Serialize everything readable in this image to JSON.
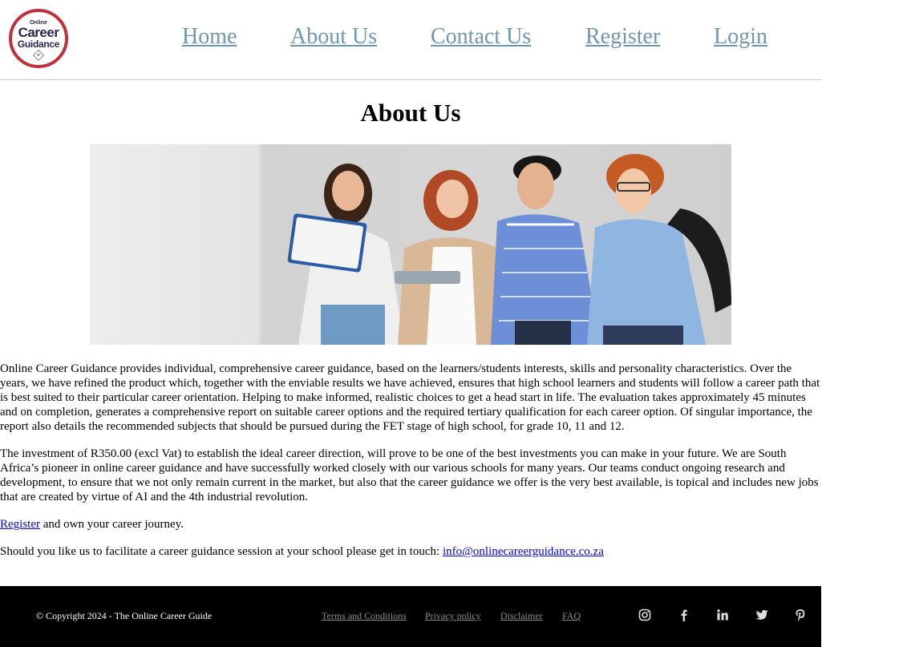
{
  "logo": {
    "line1": "Online",
    "line2": "Career",
    "line3": "Guidance"
  },
  "nav": {
    "home": "Home",
    "about": "About Us",
    "contact": "Contact Us",
    "register": "Register",
    "login": "Login"
  },
  "main": {
    "title": "About Us",
    "paragraph1": "Online Career Guidance provides individual, comprehensive career guidance, based on the learners/students interests, skills and personality characteristics. Over the years, we have refined the product which, together with the enviable results we have achieved, ensures that high school learners and students will follow a career path that is best suited to their particular career orientation. Helping to make informed, realistic choices to get a head start in life. The evaluation takes approximately 45 minutes and on completion, generates a comprehensive report on suitable career options and the required tertiary qualification for each career option. Of singular importance, the report also details the recommended subjects that should be pursued during the FET stage of high school, for grade 10, 11 and 12.",
    "paragraph2": "The investment of R350.00 (excl Vat) to establish the ideal career direction, will prove to be one of the best investments you can make in your future. We are South Africa’s pioneer in online career guidance and have successfully worked closely with our various schools for many years. Our teams conduct ongoing research and development, to ensure that we not only remain current in the market, but also that the career guidance we offer is the very best available, is topical and includes new jobs that are created by virtue of AI and the 4th industrial revolution.",
    "register_link": "Register",
    "register_suffix": " and own your career journey.",
    "contact_prefix": "Should you like us to facilitate a career guidance session at your school please get in touch: ",
    "contact_email": "info@onlinecareerguidance.co.za"
  },
  "footer": {
    "copyright": "© Copyright 2024 - The Online Career Guide",
    "terms": "Terms and Conditions",
    "privacy": "Privacy policy",
    "disclaimer": "Disclaimer",
    "faq": "FAQ",
    "social_icons": [
      "instagram-icon",
      "facebook-icon",
      "linkedin-icon",
      "twitter-icon",
      "pinterest-icon"
    ]
  },
  "colors": {
    "nav_link": "#6f97b0",
    "logo_ring": "#c0303a",
    "logo_text": "#2a2452",
    "footer_bg": "#000000",
    "footer_link": "#8c8c8c",
    "body_link": "#0000ee"
  }
}
